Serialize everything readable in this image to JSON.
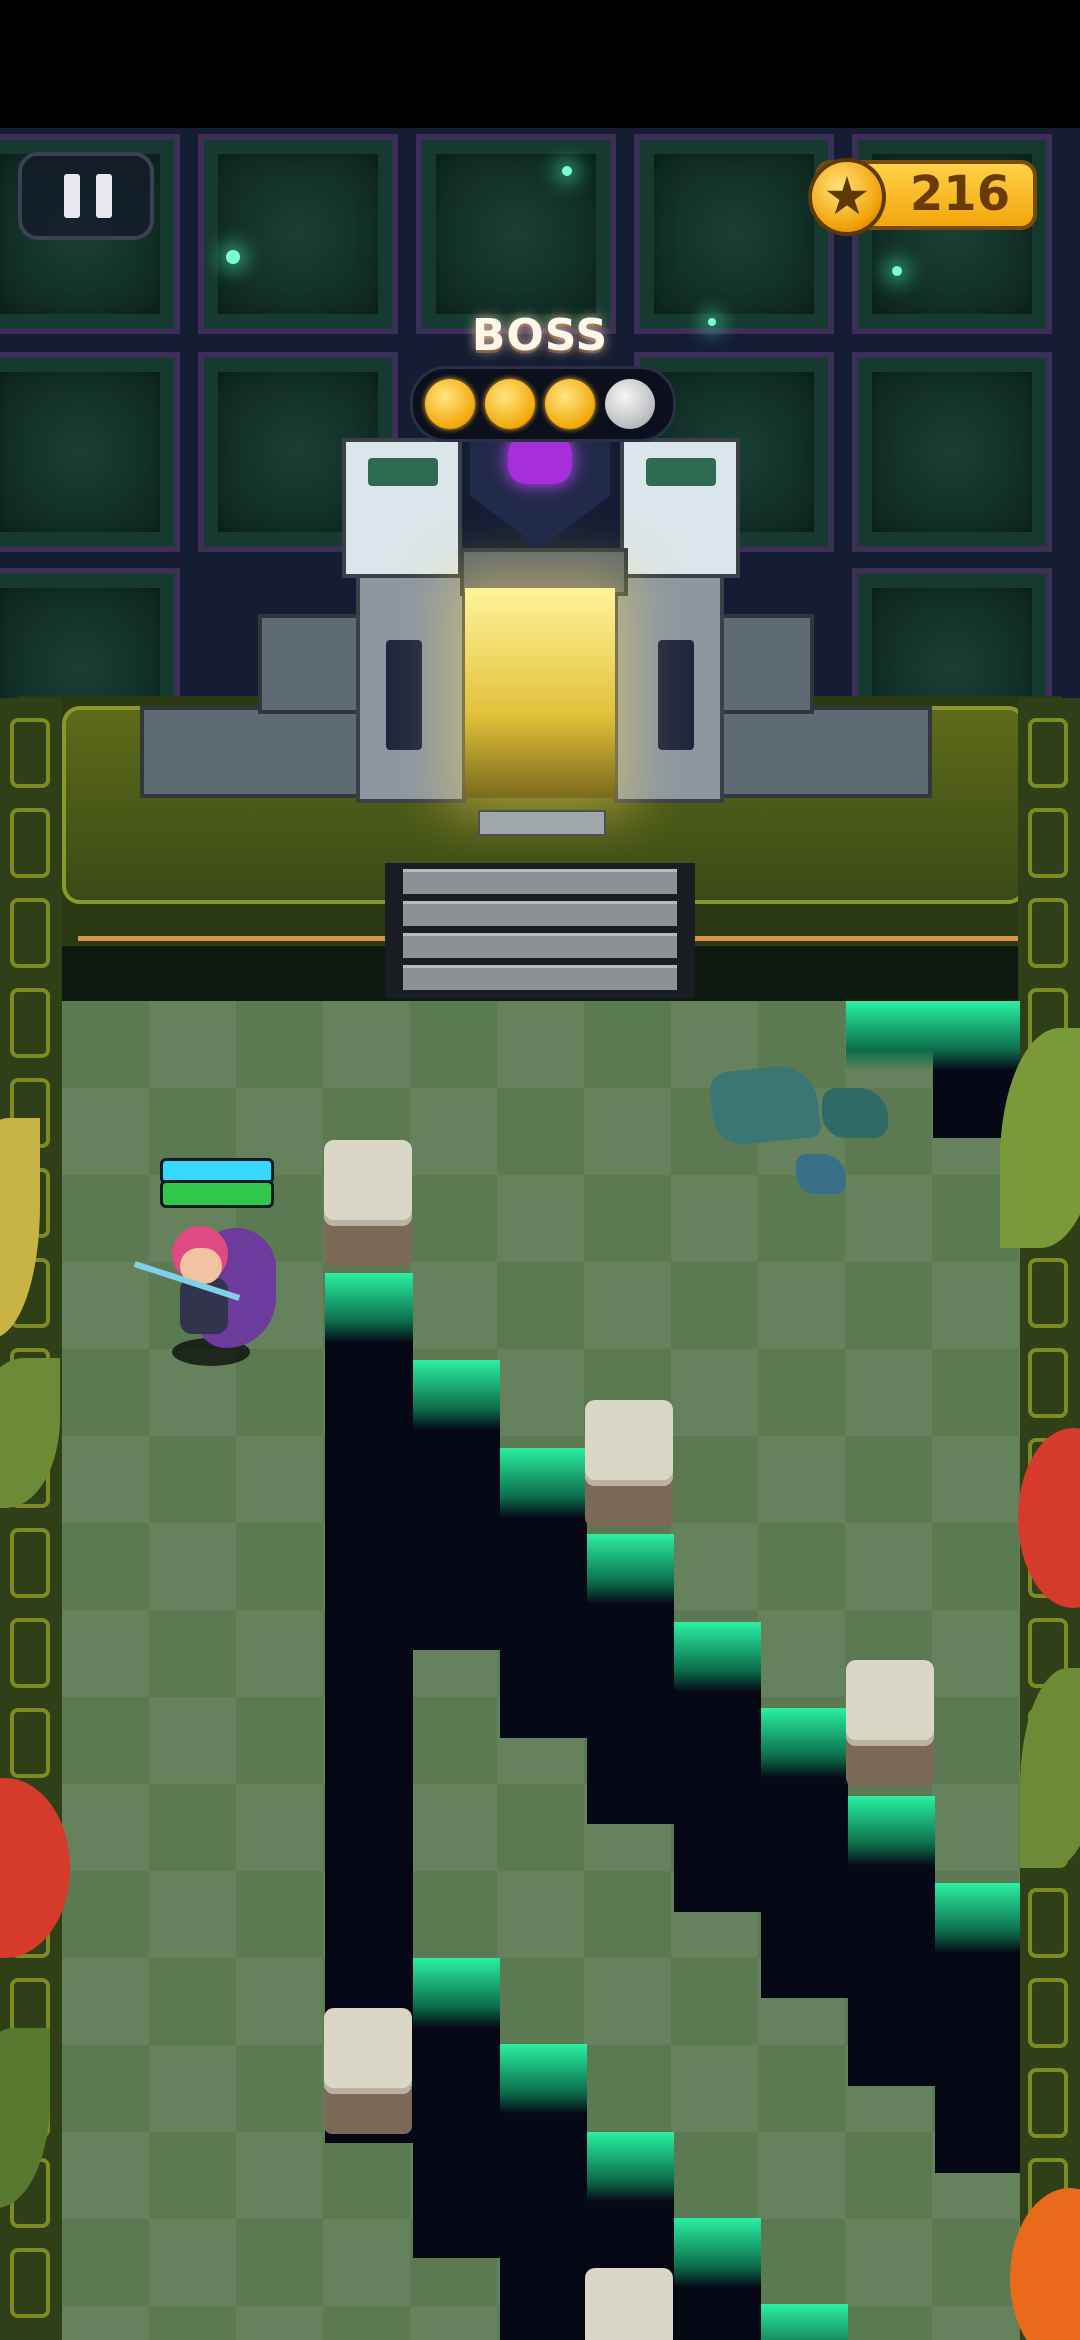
{
  "hud": {
    "pause_icon": "pause-icon",
    "coin_icon": "star-coin-icon",
    "coins": "216"
  },
  "level": {
    "boss_label": "BOSS",
    "stars_total": 4,
    "stars_earned": 3
  },
  "player": {
    "shield_level": 1.0,
    "health_level": 1.0
  },
  "colors": {
    "wall": "#0f2b24",
    "field": "#5b7a52",
    "pit_glow": "#2bf0a2",
    "coin": "#f2a60c"
  }
}
